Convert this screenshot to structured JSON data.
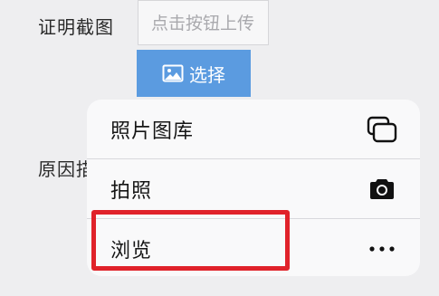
{
  "form": {
    "proof_label": "证明截图",
    "upload_placeholder": "点击按钮上传",
    "choose_button": "选择",
    "reason_label": "原因描"
  },
  "action_sheet": {
    "items": [
      {
        "label": "照片图库",
        "icon": "photo-library-icon"
      },
      {
        "label": "拍照",
        "icon": "camera-icon"
      },
      {
        "label": "浏览",
        "icon": "more-icon"
      }
    ]
  },
  "colors": {
    "accent_button": "#5b9be0",
    "highlight": "#e0222a",
    "sheet_background": "#f9f9fa"
  }
}
